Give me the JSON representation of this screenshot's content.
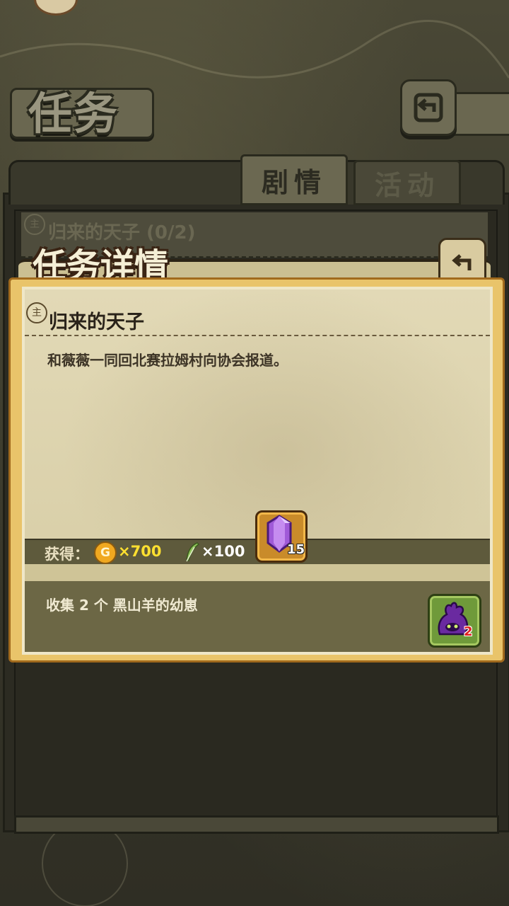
{
  "header": {
    "title": "任务"
  },
  "tabs": [
    {
      "label": "剧情",
      "active": true
    },
    {
      "label": "活动",
      "active": false
    }
  ],
  "quest_list": {
    "row_icon": "主",
    "row_title": "归来的天子 (0/2)"
  },
  "modal": {
    "title": "任务详情",
    "quest_icon": "主",
    "quest_name": "归来的天子",
    "description": "和薇薇一同回北赛拉姆村向协会报道。",
    "reward_label": "获得：",
    "coin_symbol": "G",
    "coin_value": "×700",
    "feather_value": "×100",
    "gem_count": "15",
    "objective_text": "收集 2 个 黑山羊的幼崽",
    "monster_count": "2"
  },
  "icons": {
    "back": "return-arrow-icon",
    "coin": "gold-coin-icon",
    "feather": "feather-icon",
    "gem": "purple-crystal-icon",
    "monster": "black-goat-monster-icon"
  },
  "colors": {
    "modal_border": "#e9c46a",
    "coin_text": "#ffe030",
    "monster_count": "#e02020"
  }
}
